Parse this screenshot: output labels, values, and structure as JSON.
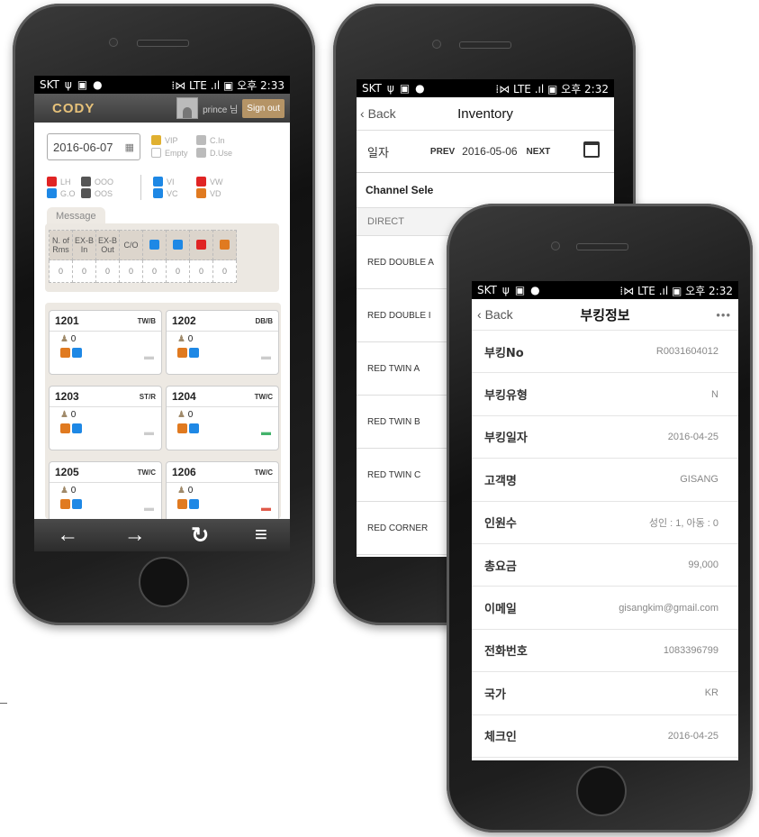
{
  "status_left": {
    "carrier": "SKT",
    "usb": "ψ",
    "img": "▣",
    "msg": "●"
  },
  "phone1": {
    "status_right": "⁞⋈ LTE .ıl ▣ 오후 2:33",
    "logo": "CODY",
    "user": "prince 님",
    "signout": "Sign out",
    "date": "2016-06-07",
    "legend": [
      {
        "label": "VIP",
        "color": "#e0b030"
      },
      {
        "label": "C.In",
        "color": "#bbbbbb"
      },
      {
        "label": "Empty",
        "color": "#ffffff"
      },
      {
        "label": "D.Use",
        "color": "#bbbbbb"
      },
      {
        "label": "LH",
        "color": "#e02424"
      },
      {
        "label": "OOO",
        "color": "#555555"
      },
      {
        "label": "G.O",
        "color": "#1e88e5"
      },
      {
        "label": "OOS",
        "color": "#555555"
      },
      {
        "label": "VI",
        "color": "#1e88e5"
      },
      {
        "label": "VW",
        "color": "#e02424"
      },
      {
        "label": "VC",
        "color": "#1e88e5"
      },
      {
        "label": "VD",
        "color": "#e07a20"
      }
    ],
    "message_tab": "Message",
    "message_headers": [
      "N. of Rms",
      "EX-B In",
      "EX-B Out",
      "C/O"
    ],
    "message_values": [
      "0",
      "0",
      "0",
      "0",
      "0",
      "0",
      "0",
      "0"
    ],
    "rooms": [
      {
        "no": "1201",
        "type": "TW/B",
        "count": "0",
        "bed_color": "#cccccc"
      },
      {
        "no": "1202",
        "type": "DB/B",
        "count": "0",
        "bed_color": "#cccccc"
      },
      {
        "no": "1203",
        "type": "ST/R",
        "count": "0",
        "bed_color": "#cccccc"
      },
      {
        "no": "1204",
        "type": "TW/C",
        "count": "0",
        "bed_color": "#43b36b"
      },
      {
        "no": "1205",
        "type": "TW/C",
        "count": "0",
        "bed_color": "#cccccc"
      },
      {
        "no": "1206",
        "type": "TW/C",
        "count": "0",
        "bed_color": "#e05a4a"
      }
    ],
    "bottom_icons": [
      "←",
      "→",
      "↻",
      "≡"
    ]
  },
  "phone2": {
    "status_right": "⁞⋈ LTE .ıl ▣ 오후 2:32",
    "back": "Back",
    "title": "Inventory",
    "date_label": "일자",
    "prev": "PREV",
    "date": "2016-05-06",
    "next": "NEXT",
    "channel": "Channel Sele",
    "direct": "DIRECT",
    "rows": [
      "RED DOUBLE A",
      "RED DOUBLE I",
      "RED TWIN A",
      "RED TWIN B",
      "RED TWIN C",
      "RED CORNER"
    ]
  },
  "phone3": {
    "status_right": "⁞⋈ LTE .ıl ▣ 오후 2:32",
    "back": "Back",
    "title": "부킹정보",
    "more": "•••",
    "fields": [
      {
        "label": "부킹No",
        "value": "R0031604012"
      },
      {
        "label": "부킹유형",
        "value": "N"
      },
      {
        "label": "부킹일자",
        "value": "2016-04-25"
      },
      {
        "label": "고객명",
        "value": "GISANG"
      },
      {
        "label": "인원수",
        "value": "성인 : 1, 아동 : 0"
      },
      {
        "label": "총요금",
        "value": "99,000"
      },
      {
        "label": "이메일",
        "value": "gisangkim@gmail.com"
      },
      {
        "label": "전화번호",
        "value": "1083396799"
      },
      {
        "label": "국가",
        "value": "KR"
      },
      {
        "label": "체크인",
        "value": "2016-04-25"
      }
    ]
  }
}
